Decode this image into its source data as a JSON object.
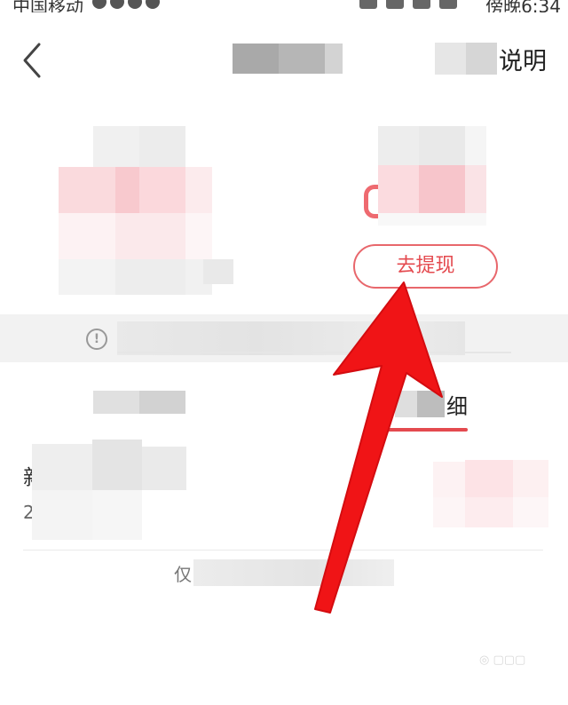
{
  "status_bar": {
    "carrier": "中国移动",
    "time": "傍晚6:34"
  },
  "header": {
    "back_icon": "chevron-left-icon",
    "explain_label": "说明"
  },
  "balance_card": {
    "withdraw_button": "去提现",
    "accent_color": "#e44a4f"
  },
  "notice": {
    "icon": "info-icon",
    "icon_glyph": "!"
  },
  "tabs": {
    "right_tab_suffix": "细"
  },
  "list": {
    "first_row_char": "新",
    "second_row_char": "2"
  },
  "footer": {
    "prefix": "仅"
  },
  "annotation": {
    "arrow_color": "#f01416"
  }
}
